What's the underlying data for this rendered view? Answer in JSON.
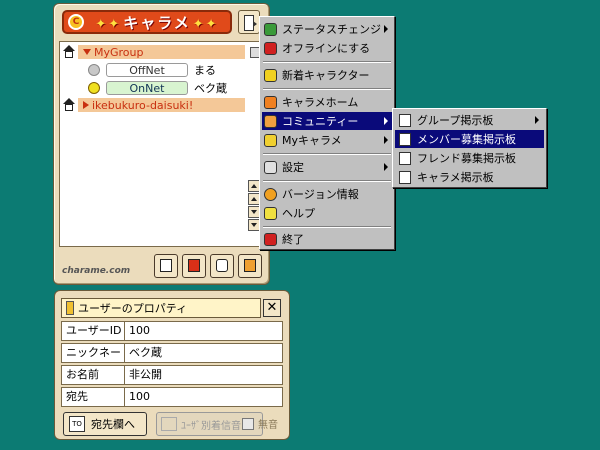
{
  "main_window": {
    "logo_text": "キャラメ",
    "logo_stars": "✦✦",
    "brand": "charame.com",
    "groups": [
      {
        "name": "MyGroup",
        "expanded": true
      },
      {
        "name": "ikebukuro-daisuki!",
        "expanded": false
      }
    ],
    "buddies": [
      {
        "status": "OffNet",
        "name": "まる"
      },
      {
        "status": "OnNet",
        "name": "ベク蔵"
      }
    ]
  },
  "menu": {
    "items": [
      {
        "label": "ステータスチェンジ",
        "icon": "status-icon",
        "submenu": true
      },
      {
        "label": "オフラインにする",
        "icon": "offline-icon",
        "submenu": false
      },
      {
        "label": "新着キャラクター",
        "icon": "new-character-icon",
        "submenu": false
      },
      {
        "label": "キャラメホーム",
        "icon": "home-icon",
        "submenu": false
      },
      {
        "label": "コミュニティー",
        "icon": "community-icon",
        "submenu": true,
        "selected": true
      },
      {
        "label": "Myキャラメ",
        "icon": "my-charame-icon",
        "submenu": true
      },
      {
        "label": "設定",
        "icon": "settings-icon",
        "submenu": true
      },
      {
        "label": "バージョン情報",
        "icon": "version-icon",
        "submenu": false
      },
      {
        "label": "ヘルプ",
        "icon": "help-icon",
        "submenu": false
      },
      {
        "label": "終了",
        "icon": "exit-icon",
        "submenu": false
      }
    ]
  },
  "submenu": {
    "items": [
      {
        "label": "グループ掲示板",
        "submenu": true
      },
      {
        "label": "メンバー募集掲示板",
        "selected": true
      },
      {
        "label": "フレンド募集掲示板"
      },
      {
        "label": "キャラメ掲示板"
      }
    ]
  },
  "property_window": {
    "title": "ユーザーのプロパティ",
    "close": "✕",
    "rows": [
      {
        "label": "ユーザーID",
        "value": "100"
      },
      {
        "label": "ニックネーム",
        "value": "ベク蔵"
      },
      {
        "label": "お名前",
        "value": "非公開"
      },
      {
        "label": "宛先",
        "value": "100"
      }
    ],
    "to_button": "宛先欄へ",
    "to_icon_text": "TO",
    "sound_button": "ﾕｰｻﾞ別着信音",
    "mute_label": "無音"
  },
  "colors": {
    "desktop": "#0c7b73",
    "window_bg": "#ebdcbc",
    "group_bar": "#f4c898",
    "menu_selected": "#0a0a7a"
  }
}
